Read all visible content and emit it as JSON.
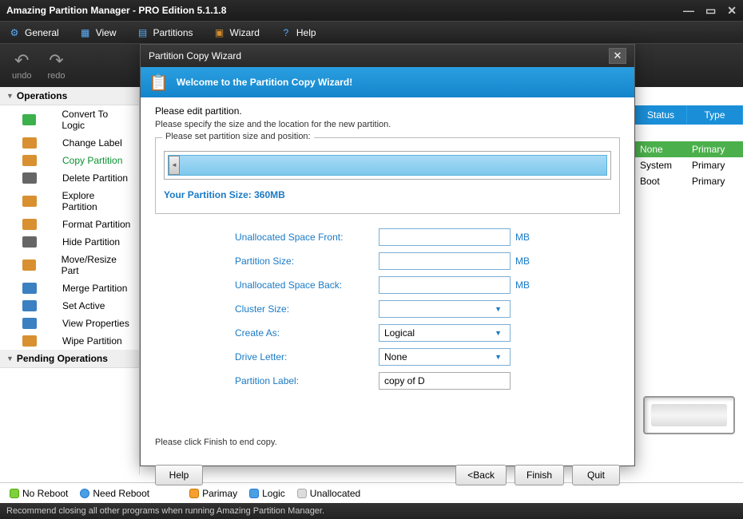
{
  "window": {
    "title": "Amazing Partition Manager - PRO Edition 5.1.1.8"
  },
  "menu": {
    "general": "General",
    "view": "View",
    "partitions": "Partitions",
    "wizard": "Wizard",
    "help": "Help"
  },
  "toolbar": {
    "undo": "undo",
    "redo": "redo"
  },
  "sidebar": {
    "operations_header": "Operations",
    "pending_header": "Pending Operations",
    "items": [
      {
        "label": "Convert To Logic",
        "color": "#3bb04b"
      },
      {
        "label": "Change Label",
        "color": "#d89030"
      },
      {
        "label": "Copy Partition",
        "color": "#d89030",
        "active": true
      },
      {
        "label": "Delete Partition",
        "color": "#666"
      },
      {
        "label": "Explore Partition",
        "color": "#d89030"
      },
      {
        "label": "Format Partition",
        "color": "#d89030"
      },
      {
        "label": "Hide Partition",
        "color": "#666"
      },
      {
        "label": "Move/Resize Part",
        "color": "#d89030"
      },
      {
        "label": "Merge Partition",
        "color": "#3b80c0"
      },
      {
        "label": "Set Active",
        "color": "#3b80c0"
      },
      {
        "label": "View Properties",
        "color": "#3b80c0"
      },
      {
        "label": "Wipe Partition",
        "color": "#d89030"
      }
    ]
  },
  "grid": {
    "headers": {
      "status": "Status",
      "type": "Type"
    },
    "rows": [
      {
        "status": "None",
        "type": "Primary",
        "green": true
      },
      {
        "status": "System",
        "type": "Primary"
      },
      {
        "status": "Boot",
        "type": "Primary"
      }
    ]
  },
  "wizard": {
    "titlebar": "Partition Copy Wizard",
    "header": "Welcome to the Partition Copy Wizard!",
    "edit_heading": "Please edit partition.",
    "edit_desc": "Please specify the size and the location for the new partition.",
    "fieldset_legend": "Please set partition size and position:",
    "size_label": "Your Partition Size: 360MB",
    "fields": {
      "unalloc_front": "Unallocated Space Front:",
      "partition_size": "Partition Size:",
      "unalloc_back": "Unallocated Space Back:",
      "cluster_size": "Cluster Size:",
      "create_as": "Create As:",
      "drive_letter": "Drive Letter:",
      "partition_label": "Partition Label:"
    },
    "values": {
      "unalloc_front": "",
      "partition_size": "",
      "unalloc_back": "",
      "cluster_size": "",
      "create_as": "Logical",
      "drive_letter": "None",
      "partition_label": "copy of D"
    },
    "unit_mb": "MB",
    "finish_note": "Please click Finish to end copy.",
    "buttons": {
      "help": "Help",
      "back": "<Back",
      "finish": "Finish",
      "quit": "Quit"
    }
  },
  "status": {
    "no_reboot": "No Reboot",
    "need_reboot": "Need Reboot",
    "primary": "Parimay",
    "logic": "Logic",
    "unallocated": "Unallocated",
    "footer": "Recommend closing all other programs when running Amazing Partition Manager."
  }
}
